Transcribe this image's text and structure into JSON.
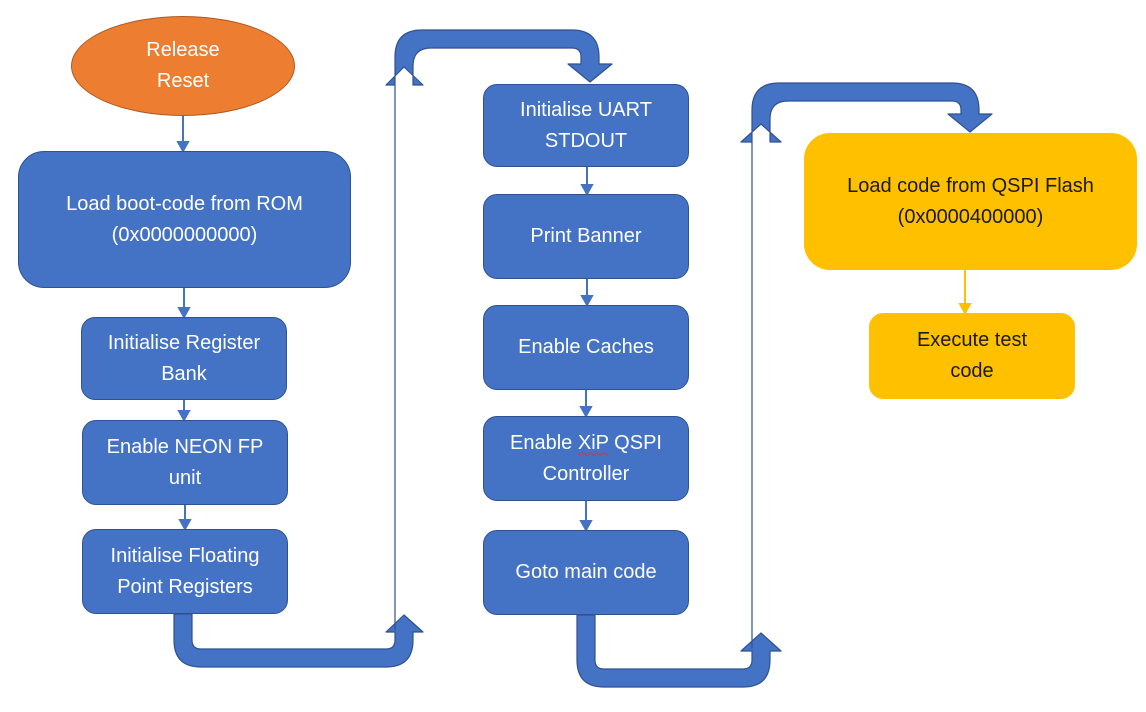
{
  "diagram": {
    "colors": {
      "process": "#4472C4",
      "process_border": "#2F528F",
      "start": "#ED7D31",
      "external": "#FFC000",
      "connector": "#4472C4"
    },
    "start": {
      "line1": "Release",
      "line2": "Reset"
    },
    "column1": [
      {
        "line1": "Load boot-code from ROM",
        "line2": "(0x0000000000)"
      },
      {
        "line1": "Initialise Register",
        "line2": "Bank"
      },
      {
        "line1": "Enable NEON FP",
        "line2": "unit"
      },
      {
        "line1": "Initialise Floating",
        "line2": "Point Registers"
      }
    ],
    "column2": [
      {
        "line1": "Initialise UART",
        "line2": "STDOUT"
      },
      {
        "line1": "Print Banner",
        "line2": ""
      },
      {
        "line1": "Enable Caches",
        "line2": ""
      },
      {
        "line1_pre": "Enable ",
        "line1_spell": "XiP",
        "line1_post": " QSPI",
        "line2": "Controller"
      },
      {
        "line1": "Goto main code",
        "line2": ""
      }
    ],
    "column3": [
      {
        "line1": "Load code from QSPI Flash",
        "line2": "(0x0000400000)"
      },
      {
        "line1": "Execute test",
        "line2": "code"
      }
    ]
  }
}
